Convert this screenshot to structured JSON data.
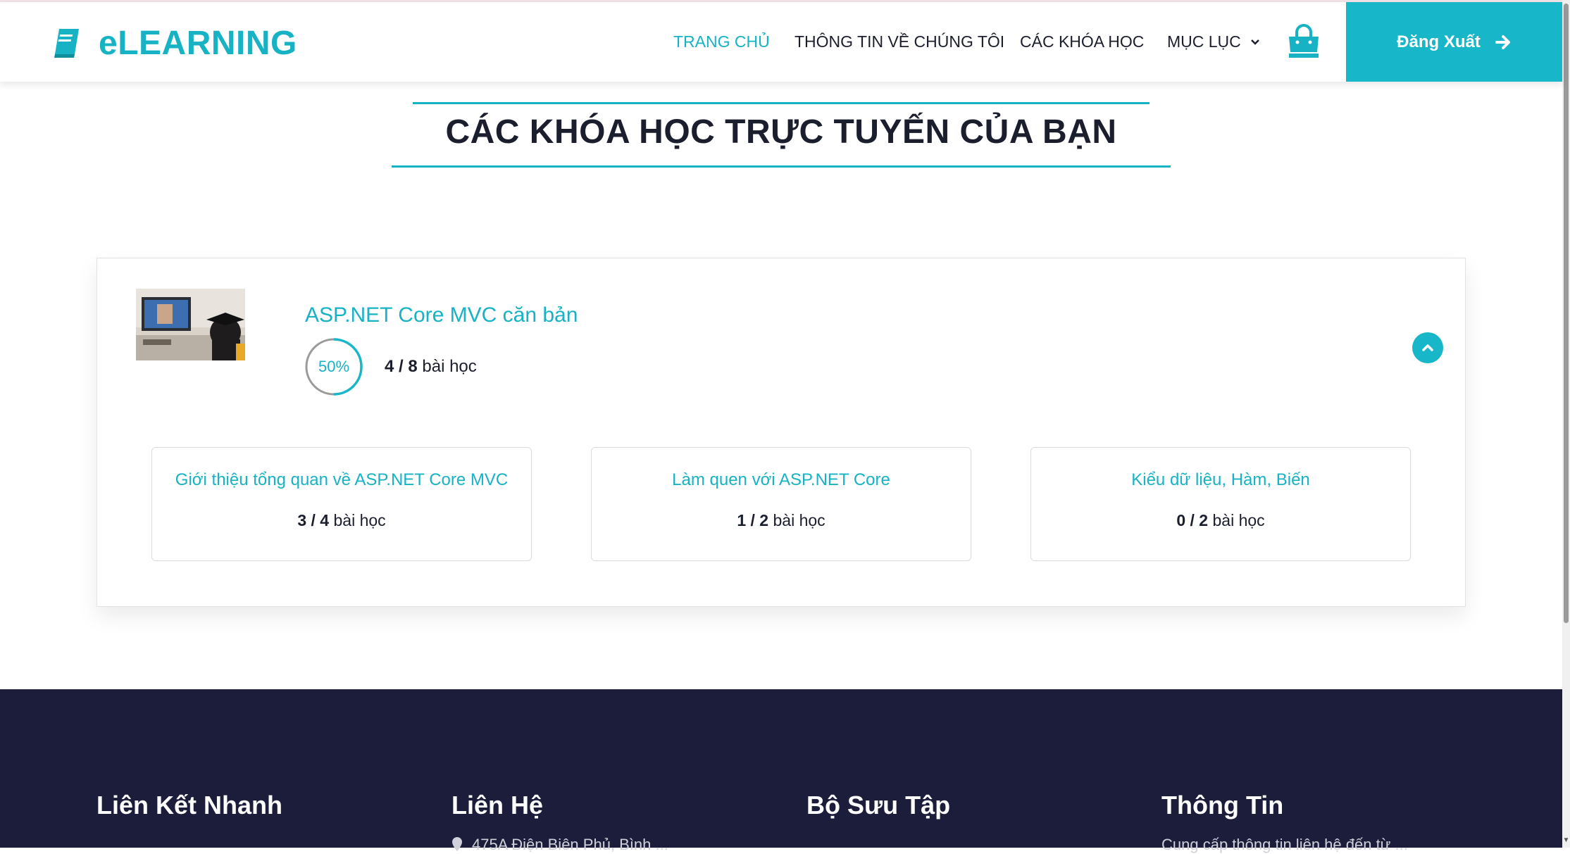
{
  "brand": {
    "name": "eLEARNING",
    "accent": "#17b2c4",
    "dark": "#1b1e2d",
    "footer_bg": "#1b1d3a"
  },
  "nav": {
    "home": "TRANG CHỦ",
    "about": "THÔNG TIN VỀ CHÚNG TÔI",
    "courses": "CÁC KHÓA HỌC",
    "menu": "MỤC LỤC",
    "cart_icon": "shopping-bag-icon",
    "logout": "Đăng Xuất"
  },
  "page": {
    "title": "CÁC KHÓA HỌC TRỰC TUYẾN CỦA BẠN"
  },
  "course": {
    "name": "ASP.NET Core MVC căn bản",
    "progress_percent": 50,
    "progress_label": "50%",
    "lessons_done": "4 / 8",
    "lessons_suffix": "bài học",
    "modules": [
      {
        "title": "Giới thiệu tổng quan về ASP.NET Core MVC",
        "count": "3 / 4",
        "suffix": "bài học"
      },
      {
        "title": "Làm quen với ASP.NET Core",
        "count": "1 / 2",
        "suffix": "bài học"
      },
      {
        "title": "Kiểu dữ liệu, Hàm, Biến",
        "count": "0 / 2",
        "suffix": "bài học"
      }
    ]
  },
  "footer": {
    "col1": "Liên Kết Nhanh",
    "col2": "Liên Hệ",
    "col3": "Bộ Sưu Tập",
    "col4": "Thông Tin",
    "col2_sub": "475A Điện Biên Phủ, Bình ...",
    "col4_sub": "Cung cấp thông tin liên hệ đến từ ..."
  }
}
